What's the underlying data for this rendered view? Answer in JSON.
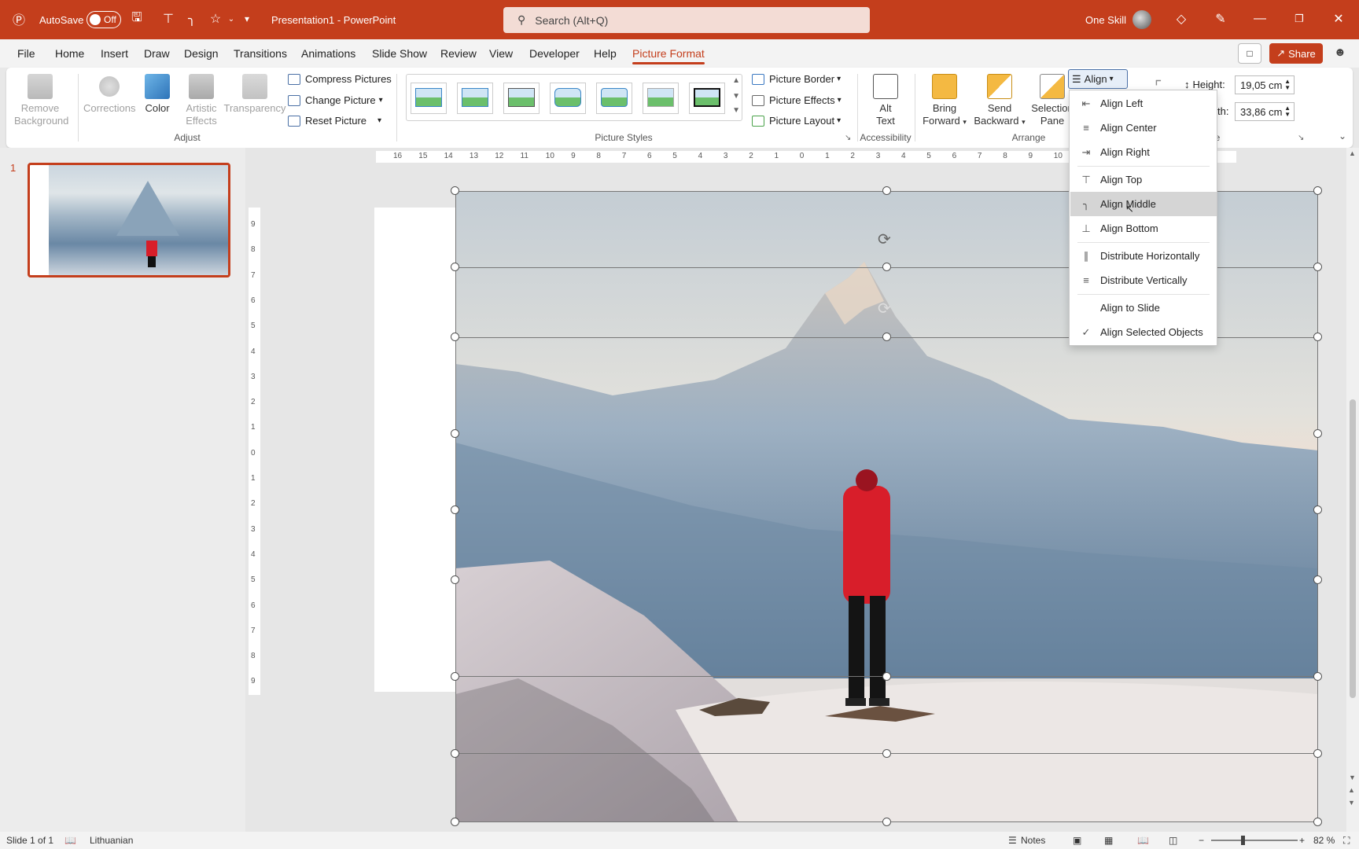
{
  "titlebar": {
    "autosave_label": "AutoSave",
    "autosave_state": "Off",
    "doc_title": "Presentation1  -  PowerPoint",
    "search_placeholder": "Search (Alt+Q)",
    "user_name": "One Skill"
  },
  "menu": {
    "tabs": [
      "File",
      "Home",
      "Insert",
      "Draw",
      "Design",
      "Transitions",
      "Animations",
      "Slide Show",
      "Review",
      "View",
      "Developer",
      "Help",
      "Picture Format"
    ],
    "active_tab": "Picture Format",
    "share_label": "Share"
  },
  "ribbon": {
    "adjust": {
      "remove_background": [
        "Remove",
        "Background"
      ],
      "corrections": "Corrections",
      "color": "Color",
      "artistic_effects": [
        "Artistic",
        "Effects"
      ],
      "transparency": "Transparency",
      "compress_pictures": "Compress Pictures",
      "change_picture": "Change Picture",
      "reset_picture": "Reset Picture",
      "group_label": "Adjust"
    },
    "picture_styles": {
      "picture_border": "Picture Border",
      "picture_effects": "Picture Effects",
      "picture_layout": "Picture Layout",
      "group_label": "Picture Styles"
    },
    "accessibility": {
      "alt_text": [
        "Alt",
        "Text"
      ],
      "group_label": "Accessibility"
    },
    "arrange": {
      "bring_forward": [
        "Bring",
        "Forward"
      ],
      "send_backward": [
        "Send",
        "Backward"
      ],
      "selection_pane": [
        "Selection",
        "Pane"
      ],
      "align": "Align",
      "group_label": "Arrange"
    },
    "size": {
      "height_label": "Height:",
      "height_value": "19,05 cm",
      "width_label": "th:",
      "width_value": "33,86 cm",
      "group_label": "e"
    }
  },
  "align_menu": {
    "items": [
      {
        "label": "Align Left",
        "icon": "align-left-icon"
      },
      {
        "label": "Align Center",
        "icon": "align-center-icon"
      },
      {
        "label": "Align Right",
        "icon": "align-right-icon"
      },
      {
        "label": "Align Top",
        "icon": "align-top-icon"
      },
      {
        "label": "Align Middle",
        "icon": "align-middle-icon"
      },
      {
        "label": "Align Bottom",
        "icon": "align-bottom-icon"
      },
      {
        "label": "Distribute Horizontally",
        "icon": "distribute-horizontally-icon"
      },
      {
        "label": "Distribute Vertically",
        "icon": "distribute-vertically-icon"
      },
      {
        "label": "Align to Slide",
        "icon": ""
      },
      {
        "label": "Align Selected Objects",
        "icon": "checkmark-icon"
      }
    ],
    "highlighted": "Align Middle",
    "checked": "Align Selected Objects"
  },
  "slides_pane": {
    "slide_number": "1"
  },
  "ruler": {
    "h_ticks": [
      "16",
      "15",
      "14",
      "13",
      "12",
      "11",
      "10",
      "9",
      "8",
      "7",
      "6",
      "5",
      "4",
      "3",
      "2",
      "1",
      "0",
      "1",
      "2",
      "3",
      "4",
      "5",
      "6",
      "7",
      "8",
      "9",
      "10"
    ],
    "v_ticks": [
      "9",
      "8",
      "7",
      "6",
      "5",
      "4",
      "3",
      "2",
      "1",
      "0",
      "1",
      "2",
      "3",
      "4",
      "5",
      "6",
      "7",
      "8",
      "9"
    ]
  },
  "statusbar": {
    "slide_info": "Slide 1 of 1",
    "language": "Lithuanian",
    "notes": "Notes",
    "zoom": "82 %"
  },
  "colors": {
    "accent": "#c43e1c",
    "jacket": "#d81e2a"
  }
}
